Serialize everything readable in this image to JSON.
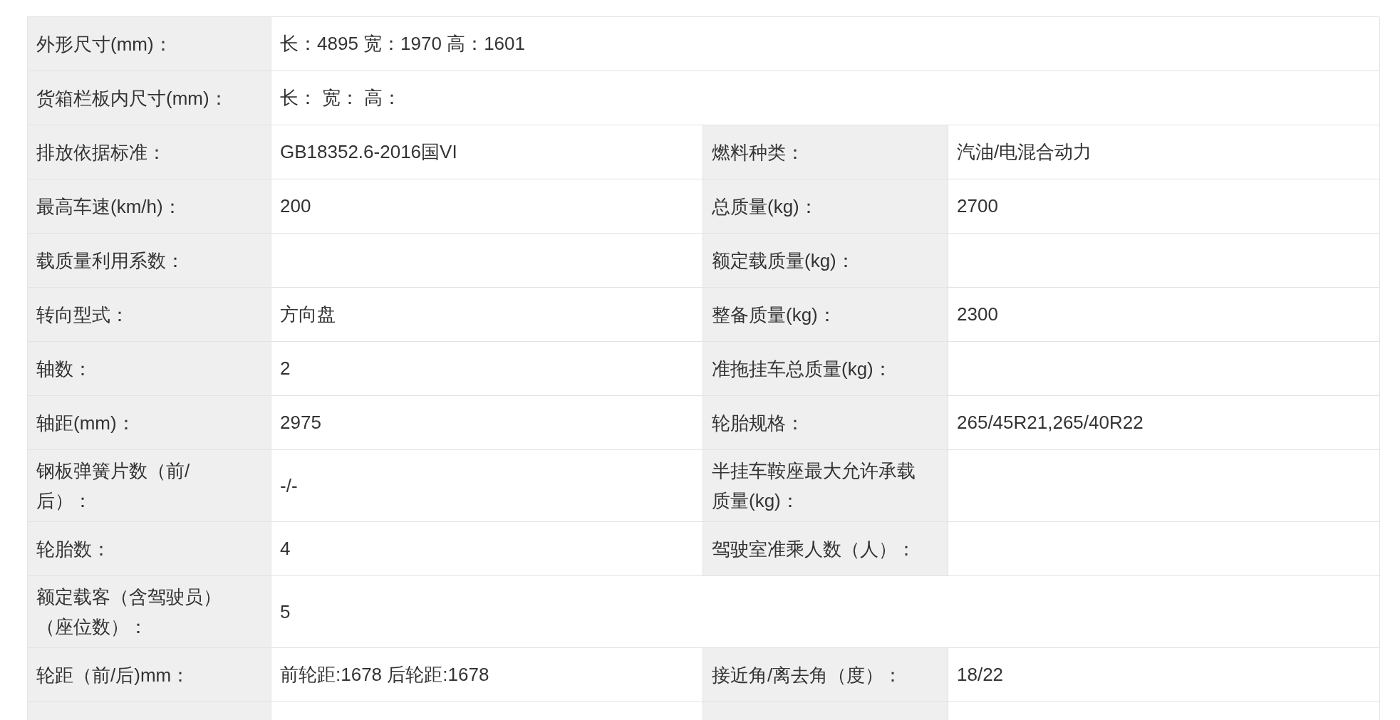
{
  "rows": [
    {
      "cells": [
        {
          "label": "外形尺寸(mm)：",
          "value": "长：4895 宽：1970 高：1601"
        }
      ]
    },
    {
      "cells": [
        {
          "label": "货箱栏板内尺寸(mm)：",
          "value": "长： 宽： 高："
        }
      ]
    },
    {
      "cells": [
        {
          "label": "排放依据标准：",
          "value": "GB18352.6-2016国VI"
        },
        {
          "label": "燃料种类：",
          "value": "汽油/电混合动力"
        }
      ]
    },
    {
      "cells": [
        {
          "label": "最高车速(km/h)：",
          "value": "200"
        },
        {
          "label": "总质量(kg)：",
          "value": "2700"
        }
      ]
    },
    {
      "cells": [
        {
          "label": "载质量利用系数："
        },
        {
          "label": "额定载质量(kg)："
        }
      ]
    },
    {
      "cells": [
        {
          "label": "转向型式：",
          "value": "方向盘"
        },
        {
          "label": "整备质量(kg)：",
          "value": "2300"
        }
      ]
    },
    {
      "cells": [
        {
          "label": "轴数：",
          "value": "2"
        },
        {
          "label": "准拖挂车总质量(kg)："
        }
      ]
    },
    {
      "cells": [
        {
          "label": "轴距(mm)：",
          "value": "2975"
        },
        {
          "label": "轮胎规格：",
          "value": "265/45R21,265/40R22"
        }
      ]
    },
    {
      "cells": [
        {
          "label": "钢板弹簧片数（前/后）：",
          "value": "-/-"
        },
        {
          "label": "半挂车鞍座最大允许承载质量(kg)："
        }
      ]
    },
    {
      "cells": [
        {
          "label": "轮胎数：",
          "value": "4"
        },
        {
          "label": "驾驶室准乘人数（人）："
        }
      ]
    },
    {
      "cells": [
        {
          "label": "额定载客（含驾驶员）（座位数）：",
          "value": "5"
        }
      ]
    },
    {
      "cells": [
        {
          "label": "轮距（前/后)mm：",
          "value": "前轮距:1678 后轮距:1678"
        },
        {
          "label": "接近角/离去角（度）：",
          "value": "18/22"
        }
      ]
    }
  ]
}
